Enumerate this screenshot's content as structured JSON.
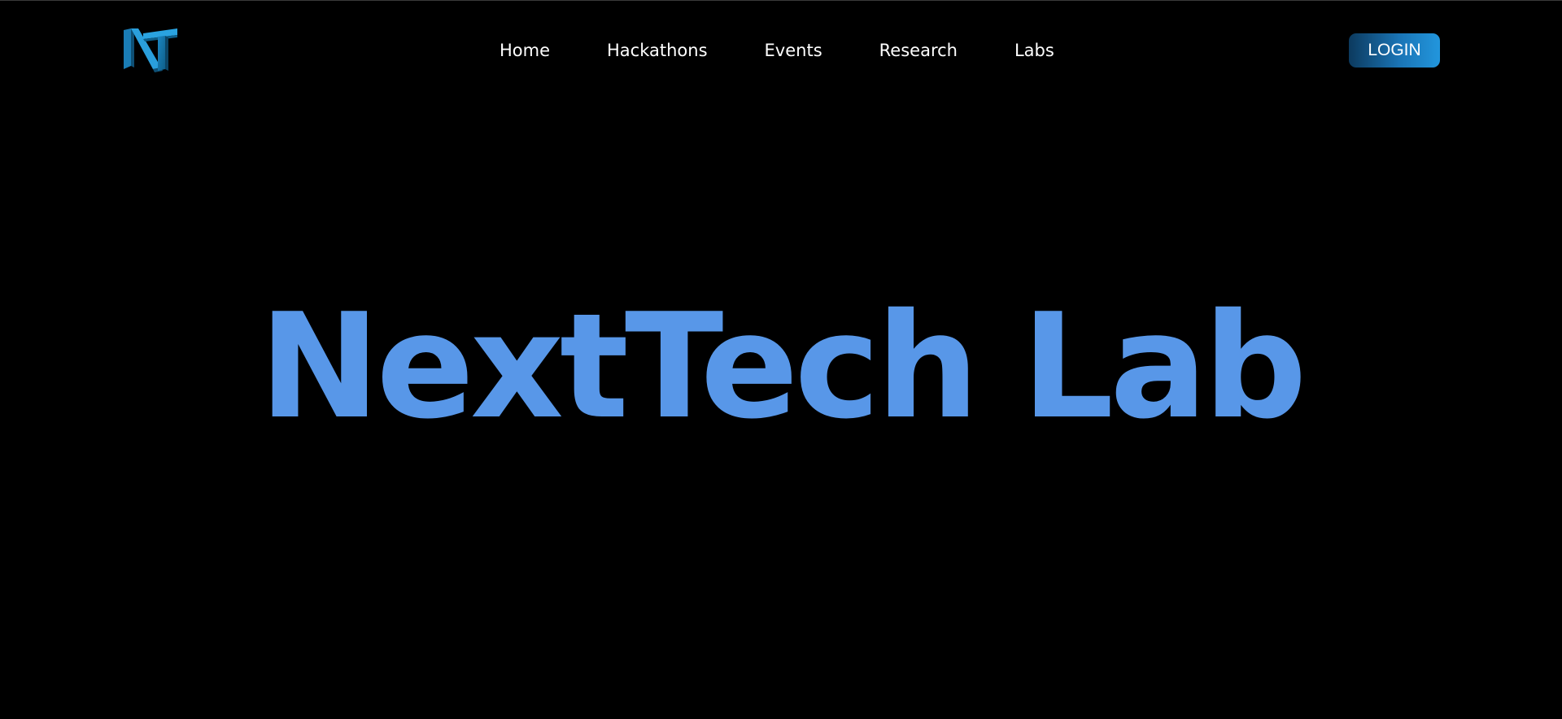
{
  "brand": {
    "logo_icon": "nxt-monogram-icon",
    "logo_colors": [
      "#0e5f8a",
      "#1b86c2",
      "#2aa3e0"
    ]
  },
  "nav": {
    "items": [
      {
        "label": "Home"
      },
      {
        "label": "Hackathons"
      },
      {
        "label": "Events"
      },
      {
        "label": "Research"
      },
      {
        "label": "Labs"
      }
    ]
  },
  "login": {
    "label": "LOGIN",
    "gradient": [
      "#0c3a5e",
      "#2296dd"
    ]
  },
  "hero": {
    "title": "NextTech Lab",
    "color": "#5897e8"
  }
}
